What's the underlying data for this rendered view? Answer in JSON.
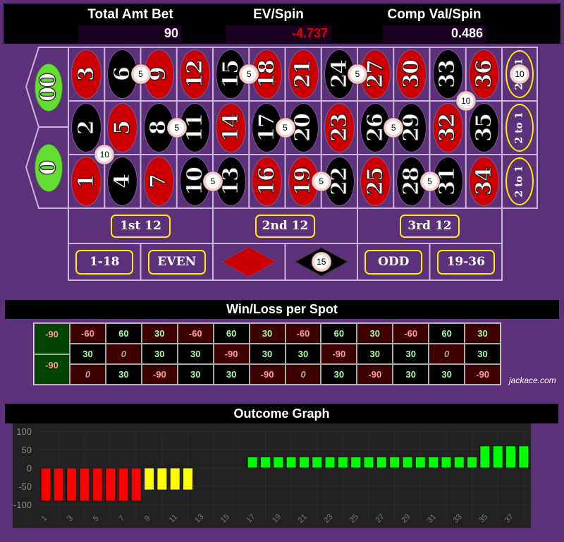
{
  "header": {
    "total_bet": {
      "label": "Total Amt Bet",
      "value": "90"
    },
    "ev_spin": {
      "label": "EV/Spin",
      "value": "-4.737",
      "color": "#e00000"
    },
    "comp_val": {
      "label": "Comp Val/Spin",
      "value": "0.486"
    }
  },
  "colors": {
    "red": "#cc0000",
    "black": "#000000",
    "green": "#66dd33",
    "accent": "#ffee00",
    "background": "#5d3179"
  },
  "board": {
    "zeros": [
      {
        "label": "00"
      },
      {
        "label": "0"
      }
    ],
    "numbers": [
      {
        "n": "1",
        "color": "red"
      },
      {
        "n": "2",
        "color": "black"
      },
      {
        "n": "3",
        "color": "red"
      },
      {
        "n": "4",
        "color": "black"
      },
      {
        "n": "5",
        "color": "red"
      },
      {
        "n": "6",
        "color": "black"
      },
      {
        "n": "7",
        "color": "red"
      },
      {
        "n": "8",
        "color": "black"
      },
      {
        "n": "9",
        "color": "red"
      },
      {
        "n": "10",
        "color": "black"
      },
      {
        "n": "11",
        "color": "black"
      },
      {
        "n": "12",
        "color": "red"
      },
      {
        "n": "13",
        "color": "black"
      },
      {
        "n": "14",
        "color": "red"
      },
      {
        "n": "15",
        "color": "black"
      },
      {
        "n": "16",
        "color": "red"
      },
      {
        "n": "17",
        "color": "black"
      },
      {
        "n": "18",
        "color": "red"
      },
      {
        "n": "19",
        "color": "red"
      },
      {
        "n": "20",
        "color": "black"
      },
      {
        "n": "21",
        "color": "red"
      },
      {
        "n": "22",
        "color": "black"
      },
      {
        "n": "23",
        "color": "red"
      },
      {
        "n": "24",
        "color": "black"
      },
      {
        "n": "25",
        "color": "red"
      },
      {
        "n": "26",
        "color": "black"
      },
      {
        "n": "27",
        "color": "red"
      },
      {
        "n": "28",
        "color": "black"
      },
      {
        "n": "29",
        "color": "black"
      },
      {
        "n": "30",
        "color": "red"
      },
      {
        "n": "31",
        "color": "black"
      },
      {
        "n": "32",
        "color": "red"
      },
      {
        "n": "33",
        "color": "black"
      },
      {
        "n": "34",
        "color": "red"
      },
      {
        "n": "35",
        "color": "black"
      },
      {
        "n": "36",
        "color": "red"
      }
    ],
    "columns": [
      "2 to 1",
      "2 to 1",
      "2 to 1"
    ],
    "dozens": [
      "1st 12",
      "2nd 12",
      "3rd 12"
    ],
    "outside": [
      {
        "label": "1-18"
      },
      {
        "label": "EVEN"
      },
      {
        "type": "red-diamond"
      },
      {
        "type": "black-diamond"
      },
      {
        "label": "ODD"
      },
      {
        "label": "19-36"
      }
    ],
    "chips": [
      {
        "target": "split",
        "numbers": [
          6,
          9
        ],
        "amount": "5"
      },
      {
        "target": "split",
        "numbers": [
          15,
          18
        ],
        "amount": "5"
      },
      {
        "target": "split",
        "numbers": [
          24,
          27
        ],
        "amount": "5"
      },
      {
        "target": "column",
        "column_row": 0,
        "amount": "10"
      },
      {
        "target": "corner",
        "numbers": [
          32,
          33,
          35,
          36
        ],
        "amount": "10"
      },
      {
        "target": "corner",
        "numbers": [
          1,
          2,
          4,
          5
        ],
        "amount": "10"
      },
      {
        "target": "split",
        "numbers": [
          8,
          11
        ],
        "amount": "5"
      },
      {
        "target": "split",
        "numbers": [
          17,
          20
        ],
        "amount": "5"
      },
      {
        "target": "split",
        "numbers": [
          26,
          29
        ],
        "amount": "5"
      },
      {
        "target": "split",
        "numbers": [
          10,
          13
        ],
        "amount": "5"
      },
      {
        "target": "split",
        "numbers": [
          19,
          22
        ],
        "amount": "5"
      },
      {
        "target": "split",
        "numbers": [
          28,
          31
        ],
        "amount": "5"
      },
      {
        "target": "outside",
        "outside_index": 3,
        "amount": "15"
      }
    ]
  },
  "win_loss": {
    "title": "Win/Loss per Spot",
    "zeros": [
      {
        "label": "00",
        "value": "-90"
      },
      {
        "label": "0",
        "value": "-90"
      }
    ],
    "rows": [
      [
        "-60",
        "60",
        "30",
        "-60",
        "60",
        "30",
        "-60",
        "60",
        "30",
        "-60",
        "60",
        "30"
      ],
      [
        "30",
        "0",
        "30",
        "30",
        "-90",
        "30",
        "30",
        "-90",
        "30",
        "30",
        "0",
        "30"
      ],
      [
        "0",
        "30",
        "-90",
        "30",
        "30",
        "-90",
        "0",
        "30",
        "-90",
        "30",
        "30",
        "-90"
      ]
    ],
    "cell_colors": {
      "red": "#3c0000",
      "black": "#000000",
      "zero": "#004400"
    },
    "watermark": "jackace.com"
  },
  "outcome_graph": {
    "title": "Outcome Graph"
  },
  "chart_data": {
    "type": "bar",
    "title": "Outcome Graph",
    "xlabel": "",
    "ylabel": "",
    "x": [
      1,
      2,
      3,
      4,
      5,
      6,
      7,
      8,
      9,
      10,
      11,
      12,
      13,
      14,
      15,
      16,
      17,
      18,
      19,
      20,
      21,
      22,
      23,
      24,
      25,
      26,
      27,
      28,
      29,
      30,
      31,
      32,
      33,
      34,
      35,
      36,
      37,
      38
    ],
    "values": [
      -90,
      -90,
      -90,
      -90,
      -90,
      -90,
      -90,
      -90,
      -60,
      -60,
      -60,
      -60,
      0,
      0,
      0,
      0,
      30,
      30,
      30,
      30,
      30,
      30,
      30,
      30,
      30,
      30,
      30,
      30,
      30,
      30,
      30,
      30,
      30,
      30,
      60,
      60,
      60,
      60
    ],
    "bar_colors": [
      "#ff0000",
      "#ff0000",
      "#ff0000",
      "#ff0000",
      "#ff0000",
      "#ff0000",
      "#ff0000",
      "#ff0000",
      "#ffff00",
      "#ffff00",
      "#ffff00",
      "#ffff00",
      "#00ff00",
      "#00ff00",
      "#00ff00",
      "#00ff00",
      "#00ff00",
      "#00ff00",
      "#00ff00",
      "#00ff00",
      "#00ff00",
      "#00ff00",
      "#00ff00",
      "#00ff00",
      "#00ff00",
      "#00ff00",
      "#00ff00",
      "#00ff00",
      "#00ff00",
      "#00ff00",
      "#00ff00",
      "#00ff00",
      "#00ff00",
      "#00ff00",
      "#00ff00",
      "#00ff00",
      "#00ff00",
      "#00ff00"
    ],
    "ylim": [
      -100,
      100
    ],
    "yticks": [
      100,
      50,
      0,
      -50,
      -100
    ],
    "xticks": [
      1,
      3,
      5,
      7,
      9,
      11,
      13,
      15,
      17,
      19,
      21,
      23,
      25,
      27,
      29,
      31,
      33,
      35,
      37
    ],
    "grid": true,
    "legend": "none"
  }
}
